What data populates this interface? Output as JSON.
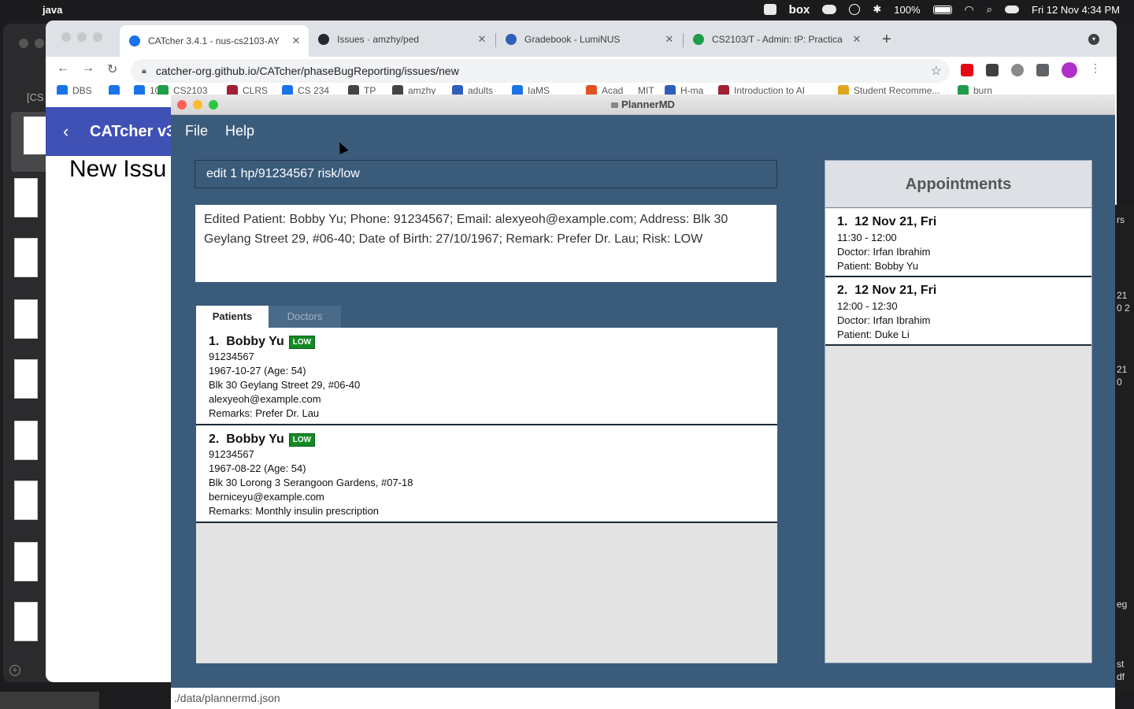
{
  "menubar": {
    "app": "java",
    "battery": "100%",
    "datetime": "Fri 12 Nov  4:34 PM",
    "box_label": "box"
  },
  "bg_left": {
    "label": "[CS"
  },
  "browser": {
    "tabs": [
      {
        "title": "CATcher 3.4.1 - nus-cs2103-AY",
        "color": "#1a73e8"
      },
      {
        "title": "Issues · amzhy/ped",
        "color": "#24292e"
      },
      {
        "title": "Gradebook - LumiNUS",
        "color": "#2f5fb8"
      },
      {
        "title": "CS2103/T - Admin: tP: Practica",
        "color": "#1e9e4a"
      }
    ],
    "url": "catcher-org.github.io/CATcher/phaseBugReporting/issues/new",
    "bookmarks": [
      "DBS",
      "10",
      "CS2103",
      "CLRS",
      "CS 234",
      "TP",
      "amzhy",
      "adults",
      "IaMS",
      "Acad",
      "MIT",
      "H-ma",
      "Introduction to AI",
      "Student Recomme...",
      "burn"
    ],
    "catcher_title": "CATcher v3",
    "catcher_heading": "New Issu"
  },
  "right_fragments": [
    "rs",
    "21",
    "0 2",
    "21",
    "0",
    "eg",
    "st",
    "df"
  ],
  "planner": {
    "window_title": "PlannerMD",
    "menu": [
      "File",
      "Help"
    ],
    "command": "edit 1 hp/91234567  risk/low",
    "result": "Edited Patient: Bobby Yu; Phone: 91234567; Email: alexyeoh@example.com; Address: Blk 30 Geylang Street 29, #06-40; Date of Birth: 27/10/1967; Remark: Prefer Dr. Lau; Risk: LOW",
    "tabs": [
      "Patients",
      "Doctors"
    ],
    "patients": [
      {
        "index": "1.",
        "name": "Bobby Yu",
        "risk": "LOW",
        "phone": "91234567",
        "dob": "1967-10-27 (Age: 54)",
        "address": "Blk 30 Geylang Street 29, #06-40",
        "email": "alexyeoh@example.com",
        "remarks": "Remarks: Prefer Dr. Lau"
      },
      {
        "index": "2.",
        "name": "Bobby Yu",
        "risk": "LOW",
        "phone": "91234567",
        "dob": "1967-08-22 (Age: 54)",
        "address": "Blk 30 Lorong 3 Serangoon Gardens, #07-18",
        "email": "berniceyu@example.com",
        "remarks": "Remarks: Monthly insulin prescription"
      }
    ],
    "appointments_title": "Appointments",
    "appointments": [
      {
        "index": "1.",
        "date": "12 Nov 21, Fri",
        "time": "11:30 - 12:00",
        "doctor": "Doctor: Irfan Ibrahim",
        "patient": "Patient: Bobby Yu"
      },
      {
        "index": "2.",
        "date": "12 Nov 21, Fri",
        "time": "12:00 - 12:30",
        "doctor": "Doctor: Irfan Ibrahim",
        "patient": "Patient: Duke Li"
      }
    ],
    "status": "./data/plannermd.json"
  }
}
